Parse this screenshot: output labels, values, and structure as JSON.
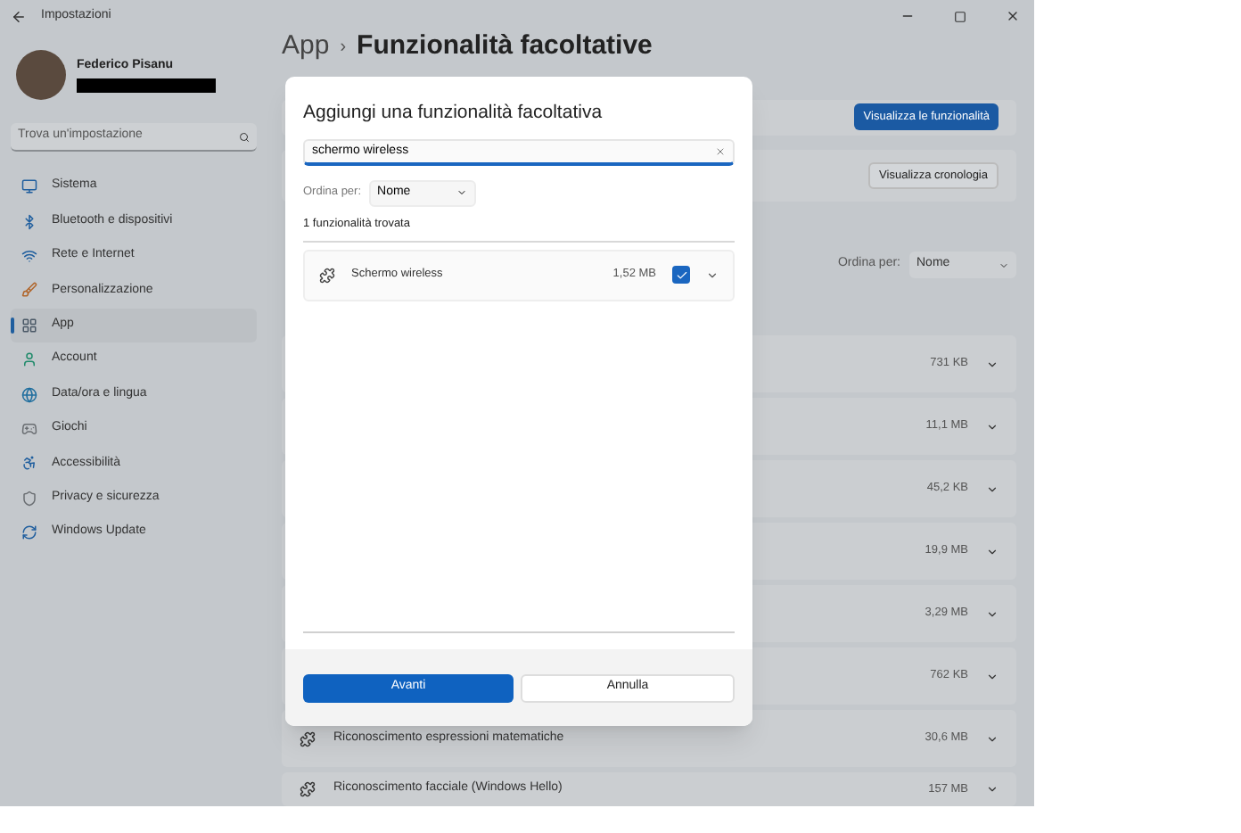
{
  "window": {
    "title": "Impostazioni"
  },
  "sidebar": {
    "user": {
      "name": "Federico Pisanu"
    },
    "search": {
      "placeholder": "Trova un'impostazione"
    },
    "items": [
      {
        "label": "Sistema",
        "selected": false,
        "kind": "system"
      },
      {
        "label": "Bluetooth e dispositivi",
        "selected": false,
        "kind": "bluetooth"
      },
      {
        "label": "Rete e Internet",
        "selected": false,
        "kind": "network"
      },
      {
        "label": "Personalizzazione",
        "selected": false,
        "kind": "brush"
      },
      {
        "label": "App",
        "selected": true,
        "kind": "apps"
      },
      {
        "label": "Account",
        "selected": false,
        "kind": "account"
      },
      {
        "label": "Data/ora e lingua",
        "selected": false,
        "kind": "globe"
      },
      {
        "label": "Giochi",
        "selected": false,
        "kind": "games"
      },
      {
        "label": "Accessibilità",
        "selected": false,
        "kind": "access"
      },
      {
        "label": "Privacy e sicurezza",
        "selected": false,
        "kind": "shield"
      },
      {
        "label": "Windows Update",
        "selected": false,
        "kind": "update"
      }
    ]
  },
  "header": {
    "breadcrumb": "App",
    "separator": "›",
    "title": "Funzionalità facoltative"
  },
  "page": {
    "view_features_button": "Visualizza le funzionalità",
    "history_button": "Visualizza cronologia",
    "sort": {
      "label": "Ordina per:",
      "value": "Nome"
    },
    "features": [
      {
        "size": "731 KB"
      },
      {
        "size": "11,1 MB"
      },
      {
        "size": "45,2 KB"
      },
      {
        "size": "19,9 MB"
      },
      {
        "size": "3,29 MB"
      },
      {
        "size": "762 KB"
      },
      {
        "name": "Riconoscimento espressioni matematiche",
        "size": "30,6 MB"
      },
      {
        "name": "Riconoscimento facciale (Windows Hello)",
        "size": "157 MB"
      }
    ]
  },
  "dialog": {
    "title": "Aggiungi una funzionalità facoltativa",
    "search": {
      "value": "schermo wireless"
    },
    "sort": {
      "label": "Ordina per:",
      "value": "Nome"
    },
    "result_count": "1 funzionalità trovata",
    "results": [
      {
        "name": "Schermo wireless",
        "size": "1,52 MB",
        "checked": true
      }
    ],
    "buttons": [
      {
        "label": "Avanti",
        "kind": "primary"
      },
      {
        "label": "Annulla",
        "kind": "secondary"
      }
    ]
  }
}
